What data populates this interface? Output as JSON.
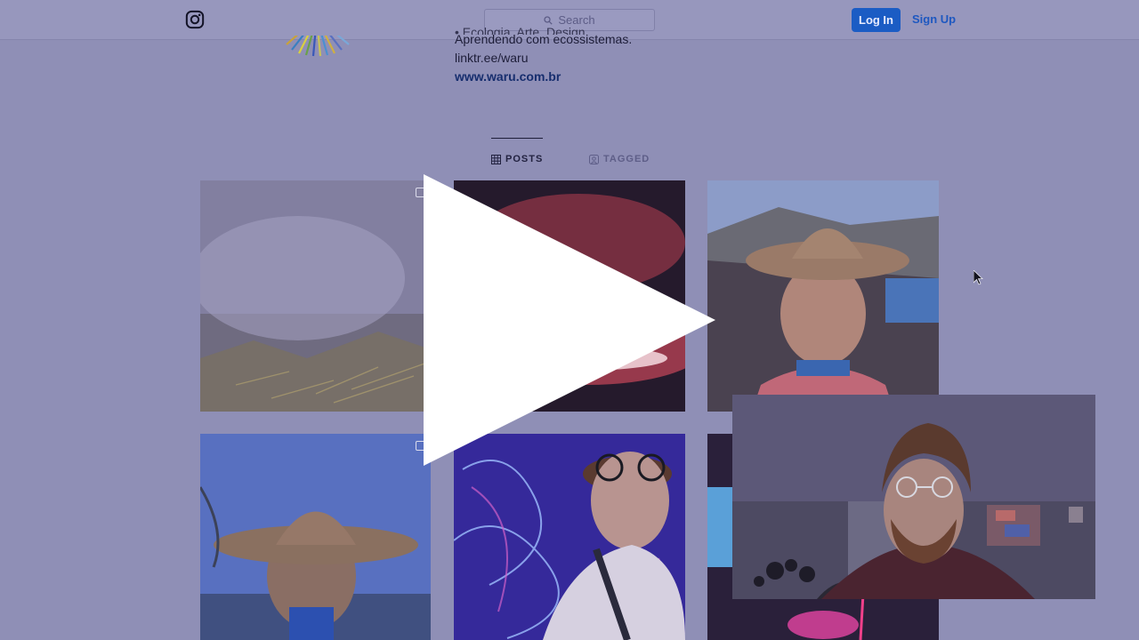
{
  "header": {
    "search_placeholder": "Search",
    "login_label": "Log In",
    "signup_label": "Sign Up"
  },
  "bio": {
    "line_partial": "• Ecologia. Arte. Design.",
    "line2": "Aprendendo com ecossistemas.",
    "line3": "linktr.ee/waru",
    "website": "www.waru.com.br"
  },
  "tabs": {
    "posts_label": "POSTS",
    "tagged_label": "TAGGED"
  },
  "colors": {
    "overlay": "#8f8fb6",
    "login_button": "#1b5cc4",
    "signup_link": "#1e58c0"
  },
  "icons": {
    "logo": "instagram-icon",
    "search": "search-icon",
    "posts_tab": "grid-icon",
    "tagged_tab": "tag-icon",
    "multi_post": "multiple-photos-icon",
    "video_play": "play-icon",
    "pointer": "mouse-cursor-icon"
  }
}
